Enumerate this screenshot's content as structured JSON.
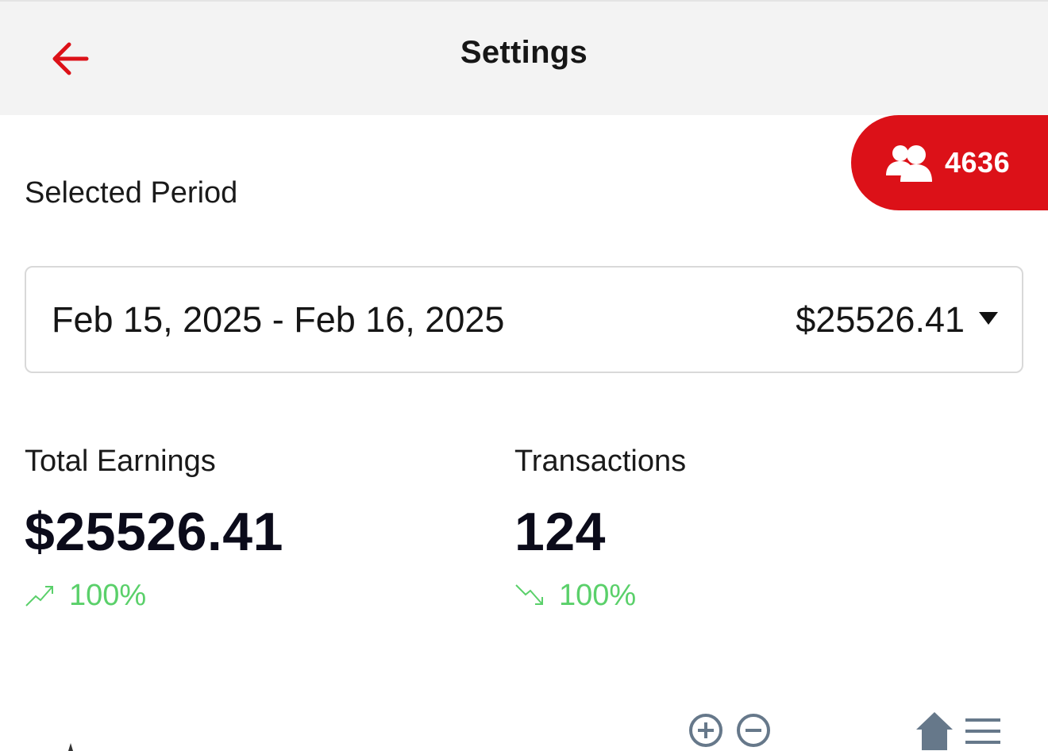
{
  "header": {
    "title": "Settings",
    "back_icon": "arrow-left-icon",
    "accent_color": "#dc1118"
  },
  "user_badge": {
    "icon": "users-icon",
    "count": "4636",
    "background": "#dc1118"
  },
  "period": {
    "label": "Selected Period",
    "range": "Feb 15, 2025 - Feb 16, 2025",
    "amount": "$25526.41",
    "dropdown_icon": "caret-down-icon"
  },
  "stats": {
    "earnings": {
      "label": "Total Earnings",
      "value": "$25526.41",
      "trend_icon": "trending-up-icon",
      "trend_pct": "100%",
      "trend_color": "#5ad06a"
    },
    "transactions": {
      "label": "Transactions",
      "value": "124",
      "trend_icon": "trending-down-icon",
      "trend_pct": "100%",
      "trend_color": "#5ad06a"
    }
  },
  "chart_toolbar": {
    "tools": [
      "zoom-in-icon",
      "zoom-out-icon",
      "home-icon",
      "menu-icon"
    ]
  }
}
